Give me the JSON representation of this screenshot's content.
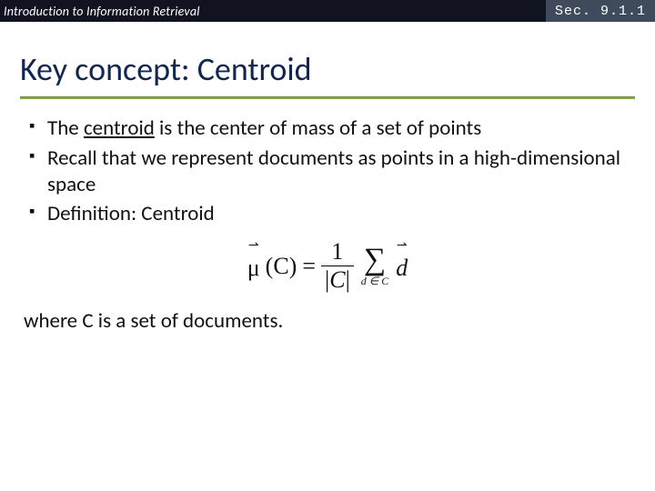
{
  "header": {
    "course": "Introduction to Information Retrieval",
    "section": "Sec. 9.1.1"
  },
  "title": "Key concept: Centroid",
  "bullets": [
    {
      "pre": "The ",
      "u": "centroid",
      "post": " is the center of mass of a set of points"
    },
    {
      "pre": "Recall that we represent documents as points in a high-dimensional space",
      "u": "",
      "post": ""
    },
    {
      "pre": "Definition: Centroid",
      "u": "",
      "post": ""
    }
  ],
  "formula": {
    "mu": "μ",
    "arg": "(C)",
    "eq": "=",
    "num": "1",
    "den_l": "|",
    "den_c": "C",
    "den_r": "|",
    "sigma": "∑",
    "sub": "d ∈ C",
    "d": "d",
    "arrow": "⇀"
  },
  "tail": "where C is a set of documents."
}
